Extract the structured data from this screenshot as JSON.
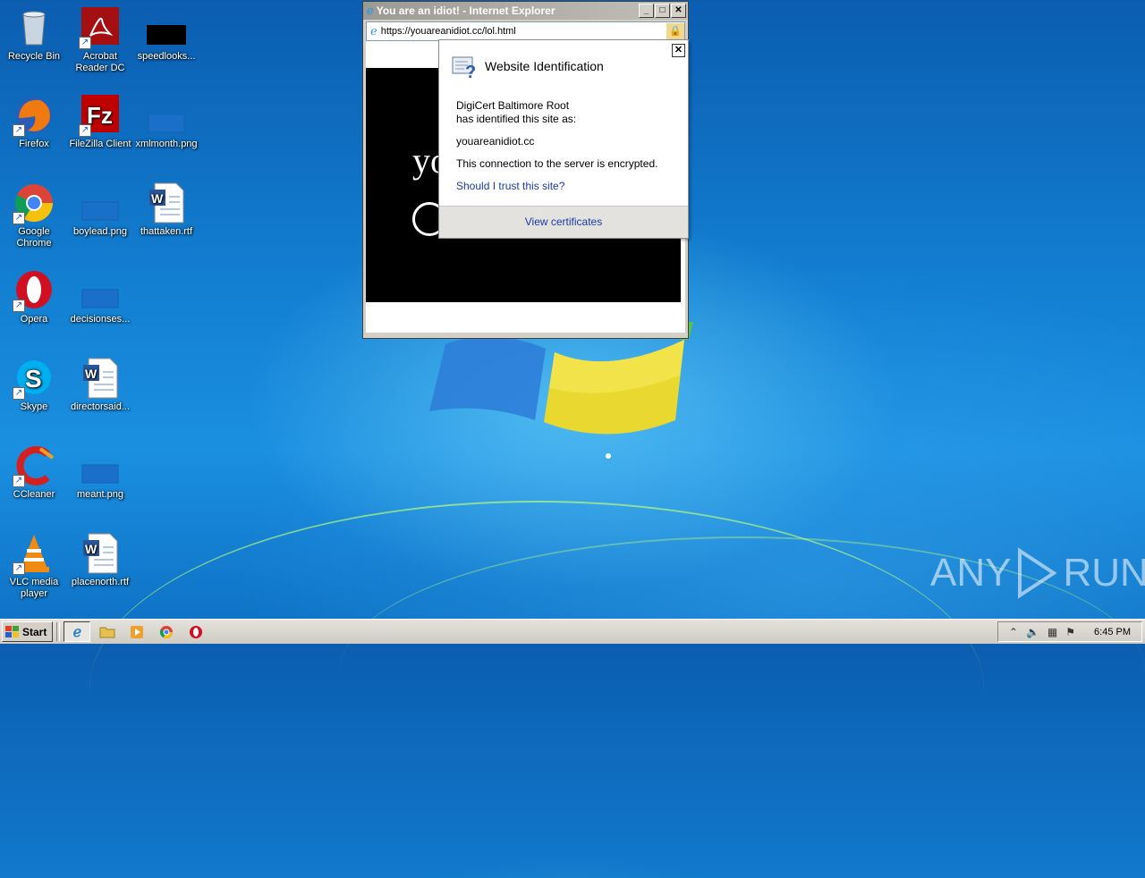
{
  "desktop": {
    "icons": [
      {
        "label": "Recycle Bin"
      },
      {
        "label": "Acrobat Reader DC"
      },
      {
        "label": "speedlooks..."
      },
      {
        "label": "Firefox"
      },
      {
        "label": "FileZilla Client"
      },
      {
        "label": "xmlmonth.png"
      },
      {
        "label": "Google Chrome"
      },
      {
        "label": "boylead.png"
      },
      {
        "label": "thattaken.rtf"
      },
      {
        "label": "Opera"
      },
      {
        "label": "decisionses..."
      },
      {
        "label": "Skype"
      },
      {
        "label": "directorsaid..."
      },
      {
        "label": "CCleaner"
      },
      {
        "label": "meant.png"
      },
      {
        "label": "VLC media player"
      },
      {
        "label": "placenorth.rtf"
      }
    ]
  },
  "ie_window": {
    "title": "You are an idiot! - Internet Explorer",
    "url": "https://youareanidiot.cc/lol.html",
    "content_text": "yo"
  },
  "popup": {
    "title": "Website Identification",
    "issuer_line1": "DigiCert Baltimore Root",
    "issuer_line2": "has identified this site as:",
    "site": "youareanidiot.cc",
    "encrypted": "This connection to the server is encrypted.",
    "trust_link": "Should I trust this site?",
    "view_certificates": "View certificates"
  },
  "taskbar": {
    "start_label": "Start",
    "clock": "6:45 PM"
  },
  "watermark": {
    "text_left": "ANY",
    "text_right": "RUN"
  }
}
